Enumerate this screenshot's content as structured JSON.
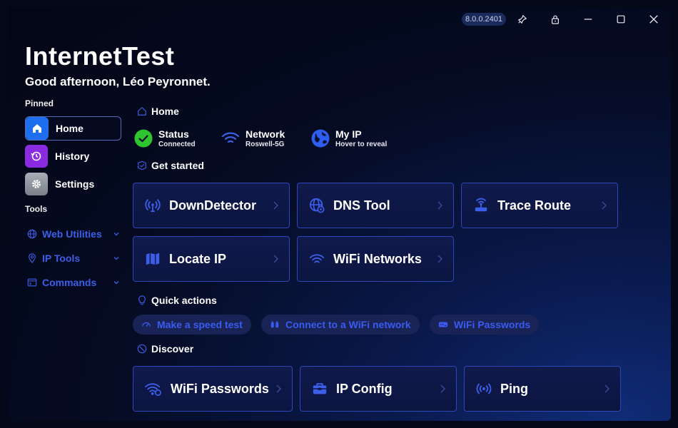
{
  "titlebar": {
    "version": "8.0.0.2401"
  },
  "app": {
    "title": "InternetTest",
    "greeting": "Good afternoon, Léo Peyronnet."
  },
  "sidebar": {
    "pinned_label": "Pinned",
    "tools_label": "Tools",
    "pinned": [
      {
        "label": "Home",
        "icon": "home-icon",
        "color": "#1e6ef0"
      },
      {
        "label": "History",
        "icon": "history-icon",
        "color": "#8a2be2"
      },
      {
        "label": "Settings",
        "icon": "gear-icon",
        "color": "#9aa0aa"
      }
    ],
    "tools": [
      {
        "label": "Web Utilities",
        "icon": "globe-icon"
      },
      {
        "label": "IP Tools",
        "icon": "location-pin-icon"
      },
      {
        "label": "Commands",
        "icon": "terminal-icon"
      }
    ]
  },
  "main": {
    "breadcrumb": "Home",
    "status": [
      {
        "title": "Status",
        "sub": "Connected"
      },
      {
        "title": "Network",
        "sub": "Roswell-5G"
      },
      {
        "title": "My IP",
        "sub": "Hover to reveal"
      }
    ],
    "get_started_label": "Get started",
    "get_started": [
      {
        "label": "DownDetector",
        "icon": "antenna-icon"
      },
      {
        "label": "DNS Tool",
        "icon": "dns-globe-icon"
      },
      {
        "label": "Trace Route",
        "icon": "router-icon"
      },
      {
        "label": "Locate IP",
        "icon": "map-icon"
      },
      {
        "label": "WiFi Networks",
        "icon": "wifi-icon"
      }
    ],
    "quick_actions_label": "Quick actions",
    "quick_actions": [
      {
        "label": "Make a speed test",
        "icon": "speedometer-icon"
      },
      {
        "label": "Connect to a WiFi network",
        "icon": "plug-icon"
      },
      {
        "label": "WiFi Passwords",
        "icon": "password-icon"
      }
    ],
    "discover_label": "Discover",
    "discover": [
      {
        "label": "WiFi Passwords",
        "icon": "wifi-lock-icon"
      },
      {
        "label": "IP Config",
        "icon": "toolbox-icon"
      },
      {
        "label": "Ping",
        "icon": "broadcast-icon"
      }
    ]
  },
  "colors": {
    "accent": "#2e46b8",
    "link": "#3d5ee8",
    "connected": "#2ec52e"
  }
}
